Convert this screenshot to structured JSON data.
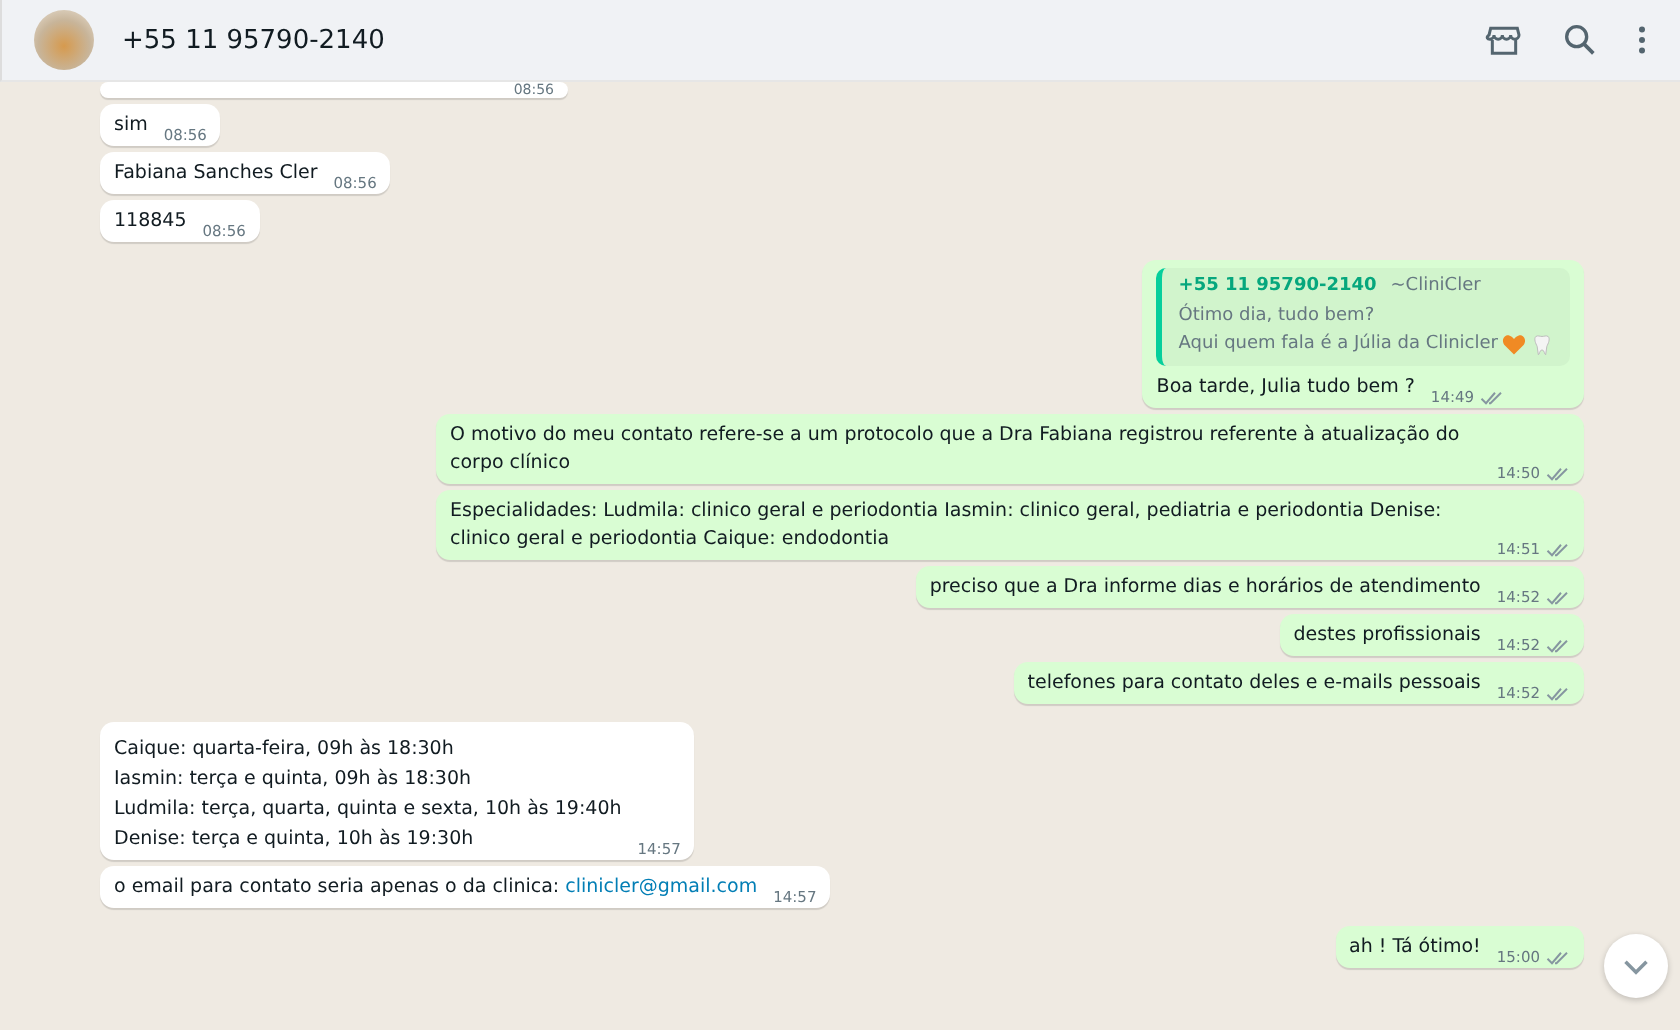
{
  "header": {
    "title": "+55 11 95790-2140"
  },
  "messages": [
    {
      "kind": "in",
      "partial": true,
      "time": "08:56"
    },
    {
      "kind": "in",
      "text": "sim",
      "time": "08:56"
    },
    {
      "kind": "in",
      "text": "Fabiana Sanches Cler",
      "time": "08:56"
    },
    {
      "kind": "in",
      "text": "118845",
      "time": "08:56"
    },
    {
      "kind": "out",
      "quote": {
        "author": "+55 11 95790-2140",
        "alias": "~CliniCler",
        "lines": [
          "Ótimo dia, tudo bem?",
          "Aqui quem fala é a Júlia da Clinicler"
        ]
      },
      "text": "Boa tarde, Julia tudo bem ?",
      "time": "14:49"
    },
    {
      "kind": "out",
      "text": "O motivo do meu contato refere-se a um protocolo que a Dra Fabiana registrou referente à atualização do corpo clínico",
      "time": "14:50"
    },
    {
      "kind": "out",
      "text": "Especialidades: Ludmila: clinico geral e periodontia Iasmin: clinico geral, pediatria e periodontia Denise: clinico geral e periodontia Caique: endodontia",
      "time": "14:51"
    },
    {
      "kind": "out",
      "text": "preciso que a Dra informe dias e horários de atendimento",
      "time": "14:52"
    },
    {
      "kind": "out",
      "text": "destes profissionais",
      "time": "14:52"
    },
    {
      "kind": "out",
      "text": "telefones para contato deles e e-mails pessoais",
      "time": "14:52"
    },
    {
      "kind": "in",
      "lines": [
        "Caique: quarta-feira, 09h às 18:30h",
        "Iasmin: terça e quinta, 09h às 18:30h",
        "Ludmila: terça, quarta, quinta e sexta, 10h às 19:40h",
        "Denise: terça e quinta, 10h às 19:30h"
      ],
      "time": "14:57"
    },
    {
      "kind": "in",
      "text": "o email para contato seria apenas o da clinica:",
      "link": "clinicler@gmail.com",
      "time": "14:57"
    },
    {
      "kind": "out",
      "text": "ah ! Tá ótimo!",
      "time": "15:00"
    }
  ]
}
